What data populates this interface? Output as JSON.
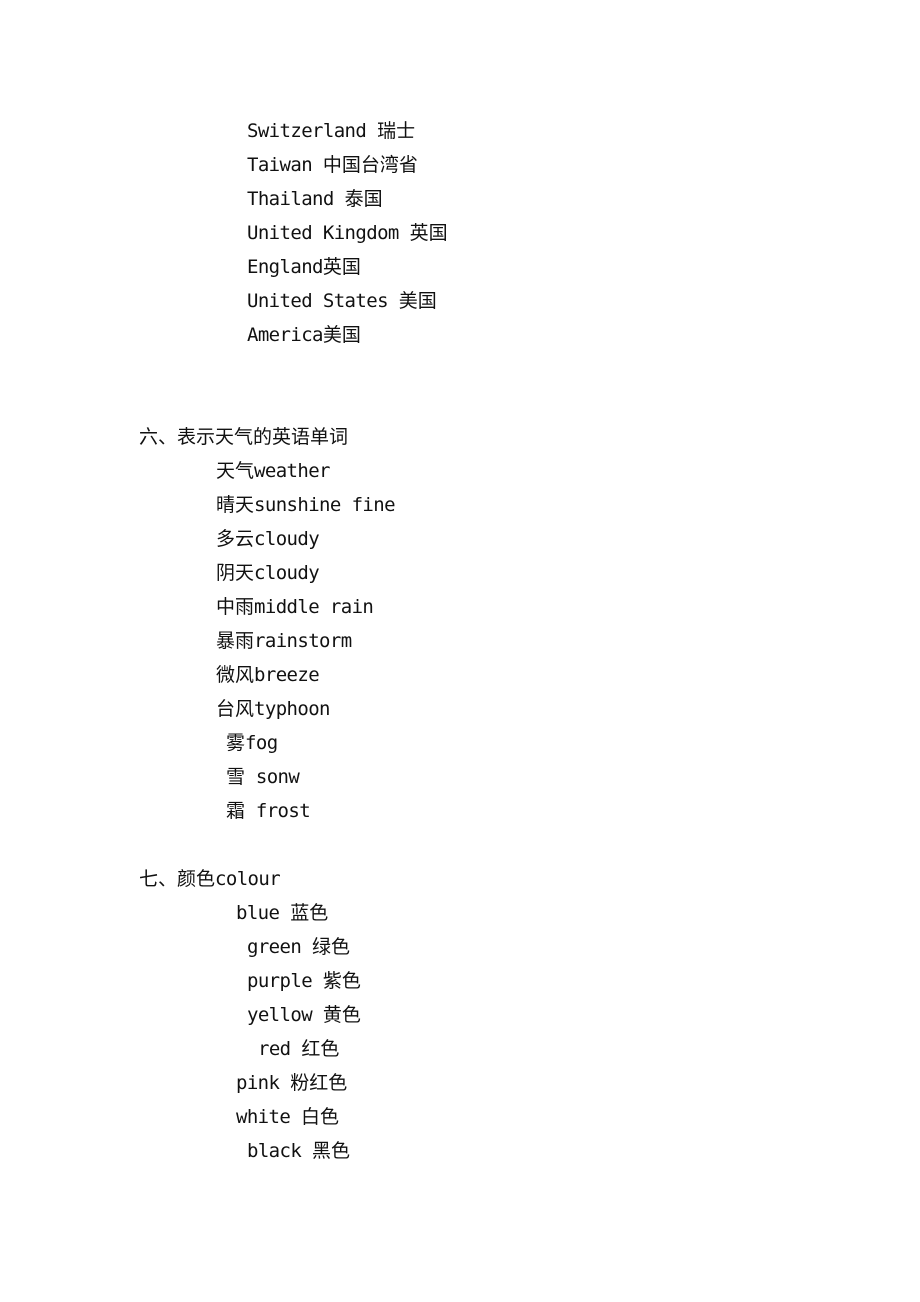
{
  "countries": {
    "items": [
      {
        "en": "Switzerland ",
        "zh": "瑞士"
      },
      {
        "en": "Taiwan ",
        "zh": "中国台湾省"
      },
      {
        "en": "Thailand ",
        "zh": "泰国"
      },
      {
        "en": "United Kingdom ",
        "zh": "英国"
      },
      {
        "en": "England",
        "zh": "英国"
      },
      {
        "en": "United States ",
        "zh": "美国"
      },
      {
        "en": "America",
        "zh": "美国"
      }
    ]
  },
  "weather": {
    "heading": "六、表示天气的英语单词",
    "items": [
      {
        "zh": "天气",
        "en": "weather"
      },
      {
        "zh": "晴天",
        "en": "sunshine fine"
      },
      {
        "zh": "多云",
        "en": "cloudy"
      },
      {
        "zh": "阴天",
        "en": "cloudy"
      },
      {
        "zh": "中雨",
        "en": "middle rain"
      },
      {
        "zh": "暴雨",
        "en": "rainstorm"
      },
      {
        "zh": "微风",
        "en": "breeze"
      },
      {
        "zh": "台风",
        "en": "typhoon"
      },
      {
        "zh": "雾",
        "en": "fog"
      },
      {
        "zh": "雪",
        "en": " sonw"
      },
      {
        "zh": "霜",
        "en": " frost"
      }
    ]
  },
  "colours": {
    "heading_zh": "七、颜色",
    "heading_en": "colour",
    "items": [
      {
        "en": "blue",
        "zh": "蓝色"
      },
      {
        "en": "green",
        "zh": "绿色"
      },
      {
        "en": "purple",
        "zh": "紫色"
      },
      {
        "en": "yellow",
        "zh": "黄色"
      },
      {
        "en": "red",
        "zh": "红色"
      },
      {
        "en": "pink",
        "zh": "粉红色"
      },
      {
        "en": "white",
        "zh": "白色"
      },
      {
        "en": "black",
        "zh": "黑色"
      }
    ]
  }
}
